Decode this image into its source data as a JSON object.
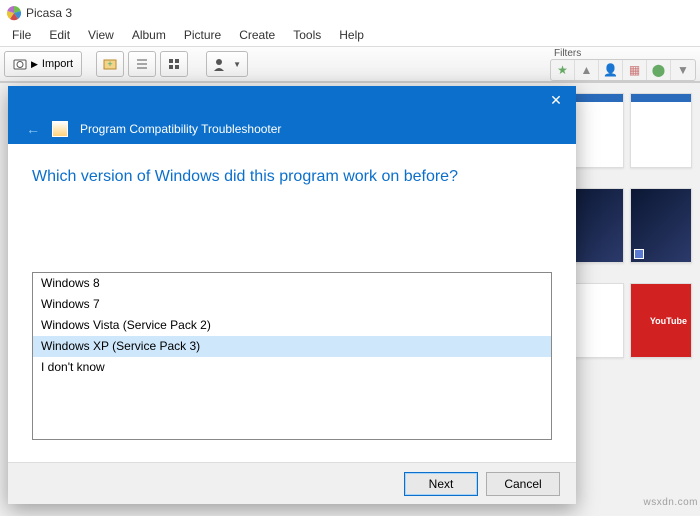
{
  "app": {
    "title": "Picasa 3"
  },
  "menu": {
    "items": [
      "File",
      "Edit",
      "View",
      "Album",
      "Picture",
      "Create",
      "Tools",
      "Help"
    ]
  },
  "toolbar": {
    "import_label": "Import",
    "filters_label": "Filters"
  },
  "dialog": {
    "header_title": "Program Compatibility Troubleshooter",
    "question": "Which version of Windows did this program work on before?",
    "options": [
      "Windows 8",
      "Windows 7",
      "Windows Vista (Service Pack 2)",
      "Windows XP (Service Pack 3)",
      "I don't know"
    ],
    "selected_index": 3,
    "next_label": "Next",
    "cancel_label": "Cancel"
  },
  "thumbs": {
    "youtube_text": "YouTube"
  },
  "watermark": "wsxdn.com"
}
